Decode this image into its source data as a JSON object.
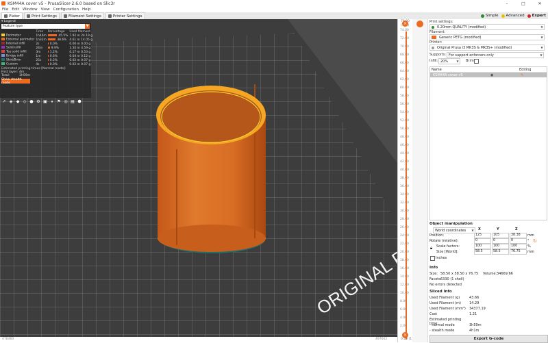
{
  "window": {
    "title": "KSM44A cover v5 - PrusaSlicer-2.6.0 based on Slic3r",
    "minimize": "–",
    "maximize": "□",
    "close": "✕"
  },
  "menu": [
    "File",
    "Edit",
    "Window",
    "View",
    "Configuration",
    "Help"
  ],
  "tabs": [
    {
      "label": "Plater",
      "active": true,
      "icon": "plater-icon"
    },
    {
      "label": "Print Settings",
      "active": false,
      "icon": "print-settings-icon"
    },
    {
      "label": "Filament Settings",
      "active": false,
      "icon": "filament-settings-icon"
    },
    {
      "label": "Printer Settings",
      "active": false,
      "icon": "printer-settings-icon"
    }
  ],
  "modes": [
    {
      "label": "Simple",
      "color": "#2d8a2d",
      "active": false
    },
    {
      "label": "Advanced",
      "color": "#e8c100",
      "active": false
    },
    {
      "label": "Expert",
      "color": "#d62828",
      "active": true
    }
  ],
  "legend": {
    "header": "Legend",
    "selector": "Feature type",
    "columns": [
      "",
      "Time",
      "Percentage",
      "Used filament"
    ],
    "rows": [
      {
        "name": "Perimeter",
        "color": "#f5d131",
        "time": "1h46m",
        "pct": "45.5%",
        "pct_value": 45.5,
        "filament": "7.92 m  24.19 g"
      },
      {
        "name": "External perimeter",
        "color": "#ed6b21",
        "time": "1h32m",
        "pct": "38.6%",
        "pct_value": 38.6,
        "filament": "4.61 m  14.05 g"
      },
      {
        "name": "Internal infill",
        "color": "#9a2a31",
        "time": "2s",
        "pct": "0.0%",
        "pct_value": 0.0,
        "filament": "0.00 m  0.00 g"
      },
      {
        "name": "Solid infill",
        "color": "#9a2bc9",
        "time": "24m",
        "pct": "9.9%",
        "pct_value": 9.9,
        "filament": "1.50 m  4.59 g"
      },
      {
        "name": "Top solid infill",
        "color": "#e33c3c",
        "time": "3m",
        "pct": "1.2%",
        "pct_value": 1.2,
        "filament": "0.17 m  0.53 g"
      },
      {
        "name": "Bridge infill",
        "color": "#7b8dd4",
        "time": "1m",
        "pct": "0.6%",
        "pct_value": 0.6,
        "filament": "0.04 m  0.12 g"
      },
      {
        "name": "Skirt/Brim",
        "color": "#1f6f6a",
        "time": "25s",
        "pct": "0.2%",
        "pct_value": 0.2,
        "filament": "0.02 m  0.07 g"
      },
      {
        "name": "Custom",
        "color": "#49b37e",
        "time": "4s",
        "pct": "0.0%",
        "pct_value": 0.0,
        "filament": "0.02 m  0.07 g"
      }
    ],
    "estimated_title": "Estimated printing times [Normal mode]:",
    "first_layer_label": "First layer:",
    "first_layer_value": "4m",
    "total_label": "Total:",
    "total_value": "3h59m",
    "stealth_button": "Show stealth mode"
  },
  "legend_toolbar": [
    "travel-icon",
    "wipe-icon",
    "retraction-icon",
    "deretraction-icon",
    "seams-icon",
    "tool-change-icon",
    "color-change-icon",
    "pause-icon",
    "custom-gcode-icon",
    "center-of-gravity-icon",
    "shells-icon",
    "tool-marker-icon"
  ],
  "bed_label": "ORIGINAL PRUSA",
  "vertical_slider": {
    "top_label": "76.80\n(384)",
    "ticks": [
      "74.00",
      "72.00",
      "70.00",
      "68.00",
      "66.00",
      "64.00",
      "62.00",
      "60.00",
      "58.00",
      "56.00",
      "54.00",
      "52.00",
      "50.00",
      "48.00",
      "46.00",
      "44.00",
      "42.00",
      "40.00",
      "38.00",
      "36.00",
      "34.00",
      "32.00",
      "30.00",
      "28.00",
      "26.00",
      "24.00",
      "22.00",
      "20.00",
      "18.00",
      "16.00",
      "14.00",
      "12.00",
      "10.00",
      "8.00",
      "6.00",
      "4.00",
      "2.00"
    ],
    "bottom_label": "0.20\n(1)"
  },
  "horizontal_slider": {
    "left": "478460",
    "right": "497602"
  },
  "settings": {
    "print_label": "Print settings:",
    "print_value": "0.20mm QUALITY (modified)",
    "filament_label": "Filament:",
    "filament_value": "Generic PETG (modified)",
    "filament_color": "#ed6b21",
    "printer_label": "Printer:",
    "printer_value": "Original Prusa i3 MK3S & MK3S+ (modified)",
    "supports_label": "Supports:",
    "supports_value": "For support enforcers only",
    "infill_label": "Infill:",
    "infill_value": "20%",
    "brim_label": "Brim:"
  },
  "object_list": {
    "col_name": "Name",
    "col_editing": "Editing",
    "rows": [
      {
        "name": "KSM44A cover v5"
      }
    ]
  },
  "object_manipulation": {
    "title": "Object manipulation",
    "coords": "World coordinates",
    "axes": [
      "X",
      "Y",
      "Z"
    ],
    "position_label": "Position:",
    "position": [
      "125",
      "105",
      "38.38"
    ],
    "position_unit": "mm",
    "rotate_label": "Rotate (relative):",
    "rotate": [
      "0",
      "0",
      "0"
    ],
    "rotate_unit": "°",
    "scale_label": "Scale factors:",
    "scale": [
      "100",
      "100",
      "100"
    ],
    "scale_unit": "%",
    "size_label": "Size [World]:",
    "size": [
      "58.5",
      "58.5",
      "76.75"
    ],
    "size_unit": "mm",
    "inches_label": "Inches"
  },
  "info": {
    "title": "Info",
    "size_label": "Size:",
    "size_value": "58.50 x 58.50 x 76.75",
    "volume_label": "Volume:",
    "volume_value": "34669.66",
    "facets_label": "Facets:",
    "facets_value": "6330 (1 shell)",
    "errors": "No errors detected"
  },
  "sliced": {
    "title": "Sliced Info",
    "rows": [
      {
        "k": "Used Filament (g)",
        "v": "43.66"
      },
      {
        "k": "Used Filament (m)",
        "v": "14.29"
      },
      {
        "k": "Used Filament (mm³)",
        "v": "34377.19"
      },
      {
        "k": "Cost",
        "v": "1.21"
      },
      {
        "k": "Estimated printing time:",
        "v": ""
      },
      {
        "k": " - normal mode",
        "v": "3h59m"
      },
      {
        "k": " - stealth mode",
        "v": "4h1m"
      }
    ]
  },
  "export_button": "Export G-code"
}
